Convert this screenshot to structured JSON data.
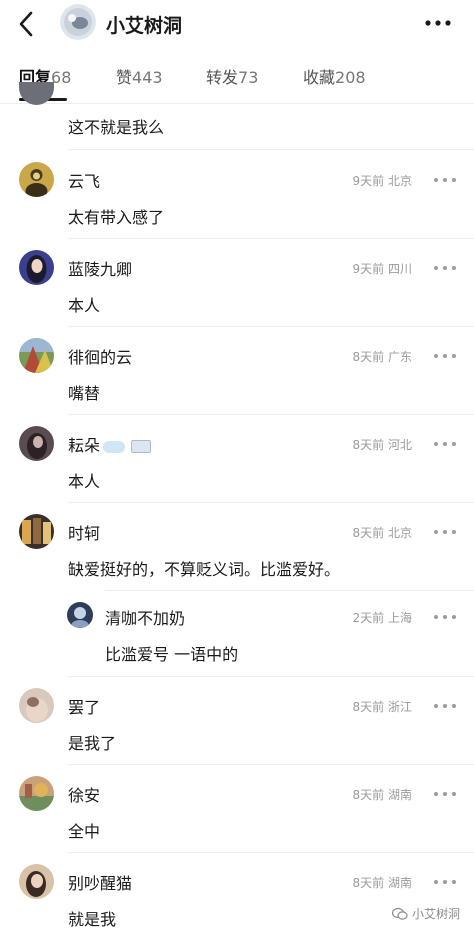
{
  "header": {
    "title": "小艾树洞",
    "back_icon": "chevron-left-icon",
    "more_icon": "more-horizontal-icon"
  },
  "tabs": [
    {
      "label": "回复",
      "count": "68",
      "active": true
    },
    {
      "label": "赞",
      "count": "443",
      "active": false
    },
    {
      "label": "转发",
      "count": "73",
      "active": false
    },
    {
      "label": "收藏",
      "count": "208",
      "active": false
    }
  ],
  "comments": [
    {
      "name": "",
      "time": "",
      "location": "",
      "text": "这不就是我么"
    },
    {
      "name": "云飞",
      "time": "9天前",
      "location": "北京",
      "text": "太有带入感了"
    },
    {
      "name": "蓝陵九卿",
      "time": "9天前",
      "location": "四川",
      "text": "本人"
    },
    {
      "name": "徘徊的云",
      "time": "8天前",
      "location": "广东",
      "text": "嘴替"
    },
    {
      "name": "耘朵",
      "time": "8天前",
      "location": "河北",
      "text": "本人"
    },
    {
      "name": "时轲",
      "time": "8天前",
      "location": "北京",
      "text": "缺爱挺好的，不算贬义词。比滥爱好。"
    },
    {
      "name": "罢了",
      "time": "8天前",
      "location": "浙江",
      "text": "是我了"
    },
    {
      "name": "徐安",
      "time": "8天前",
      "location": "湖南",
      "text": "全中"
    },
    {
      "name": "别吵醒猫",
      "time": "8天前",
      "location": "湖南",
      "text": "就是我"
    }
  ],
  "reply": {
    "name": "清咖不加奶",
    "time": "2天前",
    "location": "上海",
    "text": "比滥爱号 一语中的"
  },
  "watermark": "小艾树洞",
  "colors": {
    "meta": "#9b9b9b",
    "divider": "#eeeeee",
    "text": "#1a1a1a"
  }
}
